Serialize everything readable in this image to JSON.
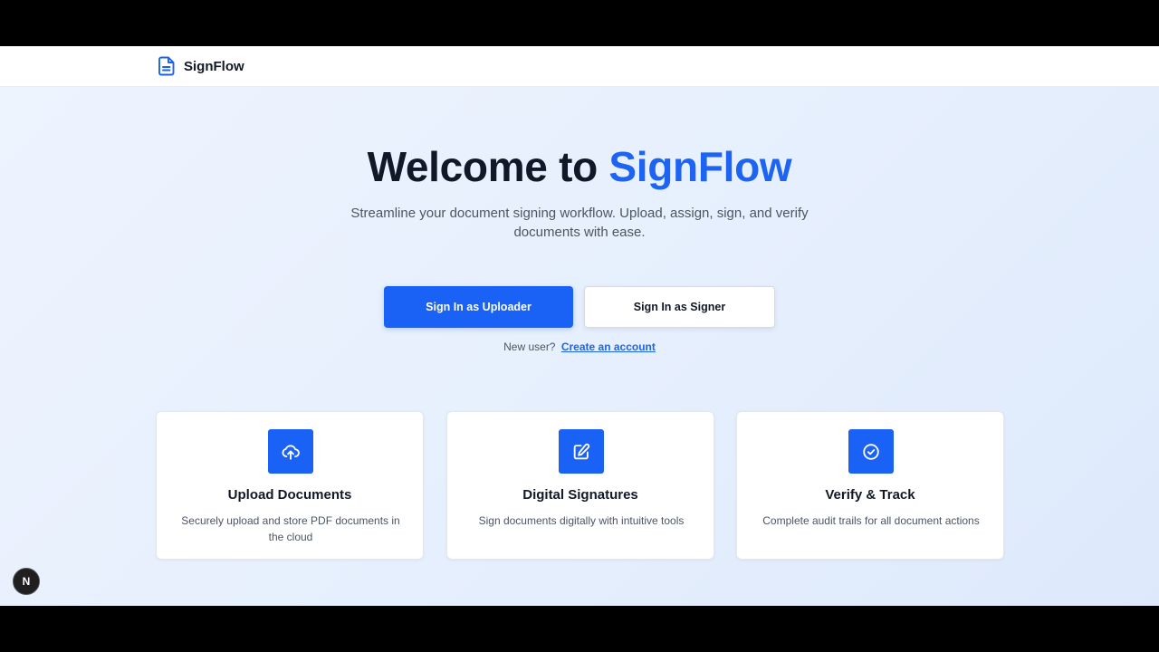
{
  "header": {
    "brand_name": "SignFlow",
    "brand_icon": "document-icon"
  },
  "hero": {
    "title_prefix": "Welcome to ",
    "title_accent": "SignFlow",
    "subtitle": "Streamline your document signing workflow. Upload, assign, sign, and verify documents with ease."
  },
  "actions": {
    "uploader_label": "Sign In as Uploader",
    "signer_label": "Sign In as Signer"
  },
  "signup": {
    "prompt": "New user?",
    "link": "Create an account"
  },
  "features": [
    {
      "icon": "cloud-upload-icon",
      "title": "Upload Documents",
      "description": "Securely upload and store PDF documents in the cloud"
    },
    {
      "icon": "edit-pen-icon",
      "title": "Digital Signatures",
      "description": "Sign documents digitally with intuitive tools"
    },
    {
      "icon": "check-circle-icon",
      "title": "Verify & Track",
      "description": "Complete audit trails for all document actions"
    }
  ],
  "dev_badge": {
    "label": "N",
    "icon": "nextjs-icon"
  },
  "colors": {
    "accent": "#1a62f5",
    "title_text": "#111827",
    "body_text": "#4b5563"
  }
}
